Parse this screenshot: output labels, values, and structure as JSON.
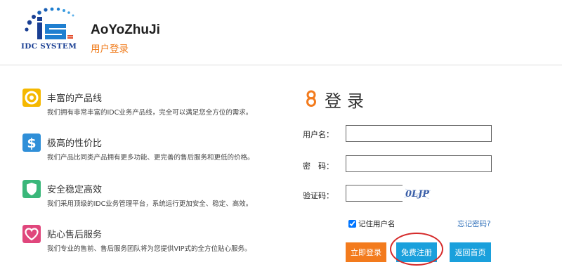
{
  "header": {
    "logo_caption": "IDC SYSTEM",
    "site_title": "AoYoZhuJi",
    "page_subtitle": "用户登录"
  },
  "features": [
    {
      "icon": "lifebuoy-icon",
      "color": "#f5b800",
      "title": "丰富的产品线",
      "desc": "我们拥有非常丰富的IDC业务产品线，完全可以满足您全方位的需求。"
    },
    {
      "icon": "dollar-icon",
      "color": "#2f8fd8",
      "title": "极高的性价比",
      "desc": "我们产品比同类产品拥有更多功能、更完善的售后服务和更低的价格。"
    },
    {
      "icon": "shield-icon",
      "color": "#3ab77a",
      "title": "安全稳定高效",
      "desc": "我们采用顶级的IDC业务管理平台，系统运行更加安全、稳定、高效。"
    },
    {
      "icon": "heart-icon",
      "color": "#e0467c",
      "title": "贴心售后服务",
      "desc": "我们专业的售前、售后服务团队将为您提供VIP式的全方位贴心服务。"
    }
  ],
  "login": {
    "title": "登录",
    "username_label": "用户名：",
    "username_value": "",
    "password_label": "密　码：",
    "password_value": "",
    "captcha_label": "验证码：",
    "captcha_value": "",
    "captcha_text": "0LJP",
    "remember_label": "记住用户名",
    "remember_checked": true,
    "forgot_link": "忘记密码?",
    "login_button": "立即登录",
    "register_button": "免费注册",
    "home_button": "返回首页"
  },
  "colors": {
    "accent_orange": "#f37b1d",
    "accent_blue": "#1aa0dc",
    "highlight_red": "#d52a2a",
    "link_blue": "#2a6cb8"
  }
}
